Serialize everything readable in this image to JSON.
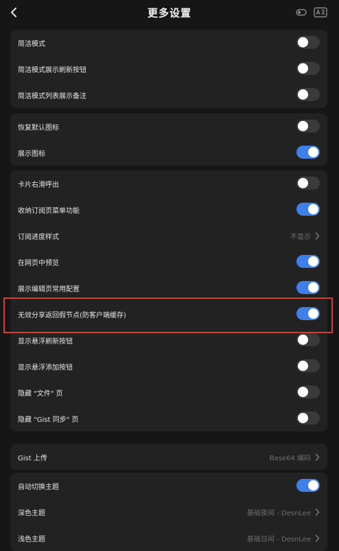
{
  "header": {
    "title": "更多设置"
  },
  "groups": [
    {
      "items": [
        {
          "label": "简洁模式",
          "on": false
        },
        {
          "label": "简洁模式展示刷新按钮",
          "on": false
        },
        {
          "label": "简洁模式列表展示备注",
          "on": false
        }
      ]
    },
    {
      "items": [
        {
          "label": "恢复默认图标",
          "on": false
        },
        {
          "label": "展示图标",
          "on": true
        }
      ]
    },
    {
      "items": [
        {
          "label": "卡片右滑呼出",
          "on": false
        },
        {
          "label": "收纳订阅页菜单功能",
          "on": true
        },
        {
          "label": "订阅进度样式",
          "value": "不显示"
        },
        {
          "label": "在网页中预览",
          "on": true
        },
        {
          "label": "展示编辑页常用配置",
          "on": true
        },
        {
          "label": "无效分享返回假节点(防客户端缓存)",
          "on": true
        },
        {
          "label": "显示悬浮刷新按钮",
          "on": false
        },
        {
          "label": "显示悬浮添加按钮",
          "on": false
        },
        {
          "label": "隐藏 \"文件\" 页",
          "on": false
        },
        {
          "label": "隐藏 \"Gist 同步\" 页",
          "on": false
        }
      ]
    },
    {
      "items": [
        {
          "label": "Gist 上传",
          "value": "Base64 编码"
        }
      ]
    },
    {
      "items": [
        {
          "label": "自动切换主题",
          "on": true
        },
        {
          "label": "深色主题",
          "value": "基础夜间 - DesnLee"
        },
        {
          "label": "浅色主题",
          "value": "基础日间 - DesnLee"
        }
      ]
    }
  ],
  "colors": {
    "accent": "#3f7fe6",
    "highlight": "#e03a2a",
    "toggle_off": "#3a3a3a"
  },
  "icons": {
    "back": "chevron-left-icon",
    "chevron": "chevron-right-icon"
  }
}
